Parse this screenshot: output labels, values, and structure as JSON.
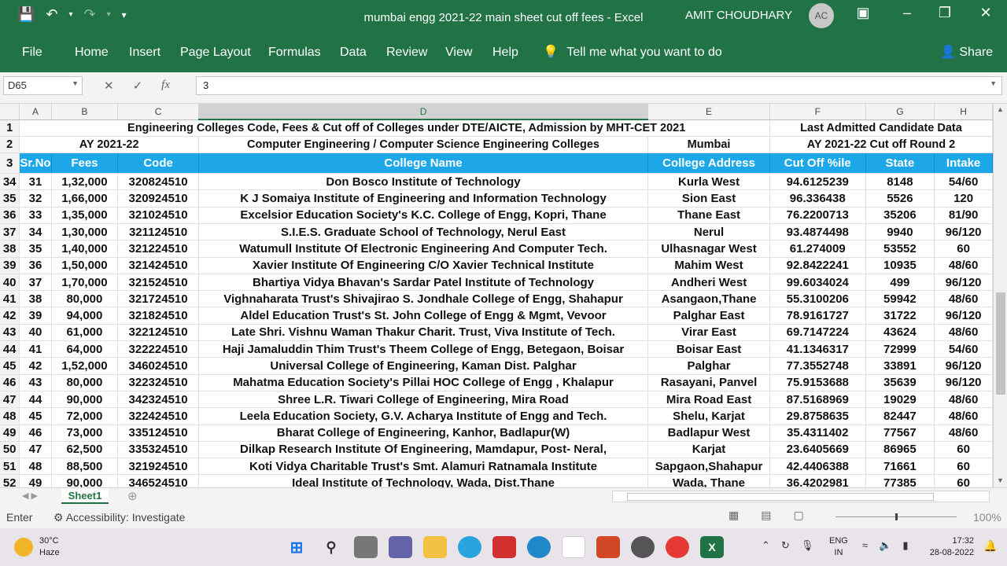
{
  "window": {
    "title": "mumbai engg 2021-22 main sheet cut off fees  -  Excel",
    "user_name": "AMIT CHOUDHARY",
    "user_initials": "AC"
  },
  "ribbon": {
    "tabs": [
      "File",
      "Home",
      "Insert",
      "Page Layout",
      "Formulas",
      "Data",
      "Review",
      "View",
      "Help"
    ],
    "tell_me": "Tell me what you want to do",
    "share": "Share"
  },
  "formula_bar": {
    "name_box": "D65",
    "formula": "3"
  },
  "columns": [
    "A",
    "B",
    "C",
    "D",
    "E",
    "F",
    "G",
    "H"
  ],
  "sheet": {
    "row1": {
      "title": "Engineering Colleges Code, Fees & Cut off of Colleges under DTE/AICTE, Admission by MHT-CET 2021",
      "right": "Last Admitted Candidate Data"
    },
    "row2": {
      "year": "AY 2021-22",
      "category": "Computer Engineering / Computer Science Engineering Colleges",
      "city": "Mumbai",
      "round": "AY 2021-22 Cut off Round 2"
    },
    "headers": [
      "Sr.No",
      "Fees",
      "Code",
      "College Name",
      "College Address",
      "Cut Off %ile",
      "State",
      "Intake"
    ],
    "rows": [
      {
        "n": "34",
        "c": [
          "31",
          "1,32,000",
          "320824510",
          "Don Bosco Institute of Technology",
          "Kurla West",
          "94.6125239",
          "8148",
          "54/60"
        ]
      },
      {
        "n": "35",
        "c": [
          "32",
          "1,66,000",
          "320924510",
          "K J Somaiya Institute of Engineering and Information Technology",
          "Sion East",
          "96.336438",
          "5526",
          "120"
        ]
      },
      {
        "n": "36",
        "c": [
          "33",
          "1,35,000",
          "321024510",
          "Excelsior Education Society's K.C. College of Engg, Kopri, Thane",
          "Thane East",
          "76.2200713",
          "35206",
          "81/90"
        ]
      },
      {
        "n": "37",
        "c": [
          "34",
          "1,30,000",
          "321124510",
          "S.I.E.S. Graduate School of Technology, Nerul East",
          "Nerul",
          "93.4874498",
          "9940",
          "96/120"
        ]
      },
      {
        "n": "38",
        "c": [
          "35",
          "1,40,000",
          "321224510",
          "Watumull Institute Of Electronic Engineering And Computer Tech.",
          "Ulhasnagar West",
          "61.274009",
          "53552",
          "60"
        ]
      },
      {
        "n": "39",
        "c": [
          "36",
          "1,50,000",
          "321424510",
          "Xavier Institute Of Engineering C/O Xavier Technical Institute",
          "Mahim West",
          "92.8422241",
          "10935",
          "48/60"
        ]
      },
      {
        "n": "40",
        "c": [
          "37",
          "1,70,000",
          "321524510",
          "Bhartiya Vidya Bhavan's Sardar Patel Institute of Technology",
          "Andheri West",
          "99.6034024",
          "499",
          "96/120"
        ]
      },
      {
        "n": "41",
        "c": [
          "38",
          "80,000",
          "321724510",
          "Vighnaharata Trust's Shivajirao S. Jondhale College of Engg, Shahapur",
          "Asangaon,Thane",
          "55.3100206",
          "59942",
          "48/60"
        ]
      },
      {
        "n": "42",
        "c": [
          "39",
          "94,000",
          "321824510",
          "Aldel Education Trust's St. John College of Engg & Mgmt, Vevoor",
          "Palghar East",
          "78.9161727",
          "31722",
          "96/120"
        ]
      },
      {
        "n": "43",
        "c": [
          "40",
          "61,000",
          "322124510",
          "Late Shri. Vishnu Waman Thakur Charit. Trust, Viva Institute of Tech.",
          "Virar East",
          "69.7147224",
          "43624",
          "48/60"
        ]
      },
      {
        "n": "44",
        "c": [
          "41",
          "64,000",
          "322224510",
          "Haji Jamaluddin Thim Trust's Theem College of Engg, Betegaon, Boisar",
          "Boisar East",
          "41.1346317",
          "72999",
          "54/60"
        ]
      },
      {
        "n": "45",
        "c": [
          "42",
          "1,52,000",
          "346024510",
          "Universal College of Engineering, Kaman Dist. Palghar",
          "Palghar",
          "77.3552748",
          "33891",
          "96/120"
        ]
      },
      {
        "n": "46",
        "c": [
          "43",
          "80,000",
          "322324510",
          "Mahatma Education Society's Pillai HOC College of Engg , Khalapur",
          "Rasayani, Panvel",
          "75.9153688",
          "35639",
          "96/120"
        ]
      },
      {
        "n": "47",
        "c": [
          "44",
          "90,000",
          "342324510",
          "Shree L.R. Tiwari College of Engineering, Mira Road",
          "Mira Road East",
          "87.5168969",
          "19029",
          "48/60"
        ]
      },
      {
        "n": "48",
        "c": [
          "45",
          "72,000",
          "322424510",
          "Leela Education Society, G.V. Acharya Institute of Engg and Tech.",
          "Shelu, Karjat",
          "29.8758635",
          "82447",
          "48/60"
        ]
      },
      {
        "n": "49",
        "c": [
          "46",
          "73,000",
          "335124510",
          "Bharat College of Engineering, Kanhor, Badlapur(W)",
          "Badlapur West",
          "35.4311402",
          "77567",
          "48/60"
        ]
      },
      {
        "n": "50",
        "c": [
          "47",
          "62,500",
          "335324510",
          "Dilkap Research Institute Of Engineering, Mamdapur, Post- Neral,",
          "Karjat",
          "23.6405669",
          "86965",
          "60"
        ]
      },
      {
        "n": "51",
        "c": [
          "48",
          "88,500",
          "321924510",
          "Koti Vidya Charitable Trust's Smt. Alamuri Ratnamala Institute",
          "Sapgaon,Shahapur",
          "42.4406388",
          "71661",
          "60"
        ]
      },
      {
        "n": "52",
        "c": [
          "49",
          "90,000",
          "346524510",
          "Ideal Institute of Technology, Wada, Dist.Thane",
          "Wada, Thane",
          "36.4202981",
          "77385",
          "60"
        ]
      }
    ]
  },
  "sheet_tab": "Sheet1",
  "status": {
    "mode": "Enter",
    "accessibility": "Accessibility: Investigate",
    "zoom": "100%"
  },
  "taskbar": {
    "temperature": "30°C",
    "weather": "Haze",
    "lang_top": "ENG",
    "lang_bottom": "IN",
    "time": "17:32",
    "date": "28-08-2022"
  },
  "colors": {
    "excel_green": "#217346",
    "header_blue": "#1ea7e8"
  }
}
